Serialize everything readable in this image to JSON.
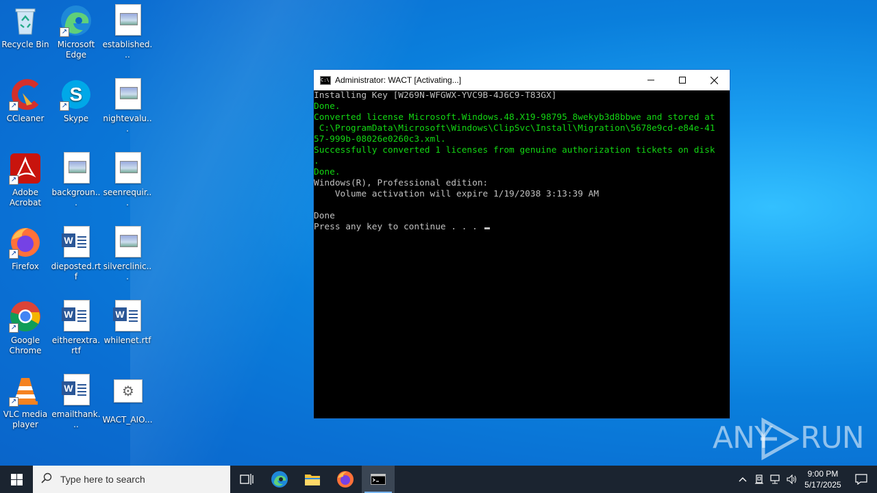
{
  "desktop": {
    "icons": [
      {
        "label": "Recycle Bin",
        "icon": "recycle-bin-icon"
      },
      {
        "label": "Microsoft Edge",
        "icon": "edge-icon"
      },
      {
        "label": "established...",
        "icon": "image-file-icon"
      },
      {
        "label": "CCleaner",
        "icon": "ccleaner-icon"
      },
      {
        "label": "Skype",
        "icon": "skype-icon"
      },
      {
        "label": "nightevalu...",
        "icon": "image-file-icon"
      },
      {
        "label": "Adobe Acrobat",
        "icon": "acrobat-icon"
      },
      {
        "label": "backgroun...",
        "icon": "image-file-icon"
      },
      {
        "label": "seenrequir...",
        "icon": "image-file-icon"
      },
      {
        "label": "Firefox",
        "icon": "firefox-icon"
      },
      {
        "label": "dieposted.rtf",
        "icon": "word-doc-icon"
      },
      {
        "label": "silverclinic...",
        "icon": "image-file-icon"
      },
      {
        "label": "Google Chrome",
        "icon": "chrome-icon"
      },
      {
        "label": "eitherextra.rtf",
        "icon": "word-doc-icon"
      },
      {
        "label": "whilenet.rtf",
        "icon": "word-doc-icon"
      },
      {
        "label": "VLC media player",
        "icon": "vlc-icon"
      },
      {
        "label": "emailthank...",
        "icon": "word-doc-icon"
      },
      {
        "label": "WACT_AIO...",
        "icon": "settings-file-icon"
      }
    ]
  },
  "console_window": {
    "title": "Administrator:  WACT [Activating...]",
    "lines": [
      {
        "text": "Installing Key [W269N-WFGWX-YVC9B-4J6C9-T83GX]",
        "color": "#c0c0c0"
      },
      {
        "text": "Done.",
        "color": "#13d613"
      },
      {
        "text": "Converted license Microsoft.Windows.48.X19-98795_8wekyb3d8bbwe and stored at",
        "color": "#13d613"
      },
      {
        "text": " C:\\ProgramData\\Microsoft\\Windows\\ClipSvc\\Install\\Migration\\5678e9cd-e84e-41",
        "color": "#13d613"
      },
      {
        "text": "57-999b-08026e0260c3.xml.",
        "color": "#13d613"
      },
      {
        "text": "Successfully converted 1 licenses from genuine authorization tickets on disk",
        "color": "#13d613"
      },
      {
        "text": ".",
        "color": "#13d613"
      },
      {
        "text": "Done.",
        "color": "#13d613"
      },
      {
        "text": "Windows(R), Professional edition:",
        "color": "#c0c0c0"
      },
      {
        "text": "    Volume activation will expire 1/19/2038 3:13:39 AM",
        "color": "#c0c0c0"
      },
      {
        "text": "",
        "color": "#c0c0c0"
      },
      {
        "text": "Done",
        "color": "#c0c0c0"
      },
      {
        "text": "Press any key to continue . . . ",
        "color": "#c0c0c0"
      }
    ]
  },
  "watermark": {
    "left": "ANY",
    "right": "RUN"
  },
  "taskbar": {
    "search_placeholder": "Type here to search",
    "clock_time": "9:00 PM",
    "clock_date": "5/17/2025"
  }
}
